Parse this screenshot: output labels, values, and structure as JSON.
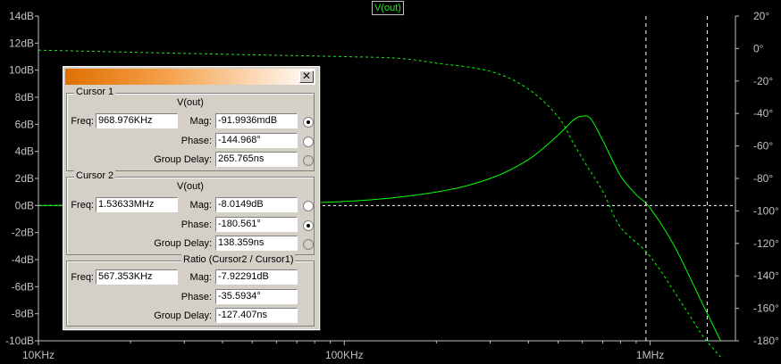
{
  "plot": {
    "trace_name": "V(out)",
    "left_axis_ticks": [
      "14dB",
      "12dB",
      "10dB",
      "8dB",
      "6dB",
      "4dB",
      "2dB",
      "0dB",
      "-2dB",
      "-4dB",
      "-6dB",
      "-8dB",
      "-10dB"
    ],
    "right_axis_ticks": [
      "20°",
      "0°",
      "-20°",
      "-40°",
      "-60°",
      "-80°",
      "-100°",
      "-120°",
      "-140°",
      "-160°",
      "-180°"
    ],
    "x_axis_ticks": [
      "10KHz",
      "100KHz",
      "1MHz"
    ],
    "colors": {
      "background": "#000000",
      "trace": "#00ff00",
      "grid": "#ffffff",
      "axis_text": "#c0c0c0"
    }
  },
  "chart_data": {
    "type": "line",
    "x_scale": "log",
    "xlim_hz": [
      10000,
      1900000
    ],
    "ylim_left_db": [
      -10,
      14
    ],
    "ylim_right_deg": [
      -180,
      20
    ],
    "cursors_hz": [
      968976,
      1536330
    ],
    "series": [
      {
        "style": "solid",
        "axis": "left",
        "x_hz": [
          10000,
          30000,
          100000,
          200000,
          300000,
          400000,
          500000,
          560000,
          600000,
          640000,
          700000,
          800000,
          900000,
          1000000,
          1200000,
          1500000,
          1700000
        ],
        "y_db": [
          0.0,
          0.05,
          0.3,
          1.0,
          2.0,
          3.4,
          5.2,
          6.3,
          6.6,
          6.4,
          4.8,
          2.2,
          0.8,
          -0.2,
          -3.0,
          -7.5,
          -10.0
        ]
      },
      {
        "style": "dashed",
        "axis": "right",
        "x_hz": [
          10000,
          30000,
          100000,
          150000,
          200000,
          300000,
          400000,
          500000,
          560000,
          620000,
          700000,
          800000,
          1000000,
          1300000,
          1500000,
          1700000
        ],
        "y_deg": [
          -1,
          -3,
          -5,
          -6,
          -9,
          -14,
          -25,
          -42,
          -58,
          -72,
          -88,
          -110,
          -128,
          -160,
          -178,
          -190
        ]
      }
    ]
  },
  "dialog": {
    "cursor1": {
      "title": "Cursor 1",
      "trace": "V(out)",
      "freq_label": "Freq:",
      "freq": "968.976KHz",
      "mag_label": "Mag:",
      "mag": "-91.9936mdB",
      "phase_label": "Phase:",
      "phase": "-144.968°",
      "gd_label": "Group Delay:",
      "gd": "265.765ns"
    },
    "cursor2": {
      "title": "Cursor 2",
      "trace": "V(out)",
      "freq_label": "Freq:",
      "freq": "1.53633MHz",
      "mag_label": "Mag:",
      "mag": "-8.0149dB",
      "phase_label": "Phase:",
      "phase": "-180.561°",
      "gd_label": "Group Delay:",
      "gd": "138.359ns"
    },
    "ratio": {
      "title": "Ratio (Cursor2 / Cursor1)",
      "freq_label": "Freq:",
      "freq": "567.353KHz",
      "mag_label": "Mag:",
      "mag": "-7.92291dB",
      "phase_label": "Phase:",
      "phase": "-35.5934°",
      "gd_label": "Group Delay:",
      "gd": "-127.407ns"
    },
    "close_glyph": "✕"
  }
}
